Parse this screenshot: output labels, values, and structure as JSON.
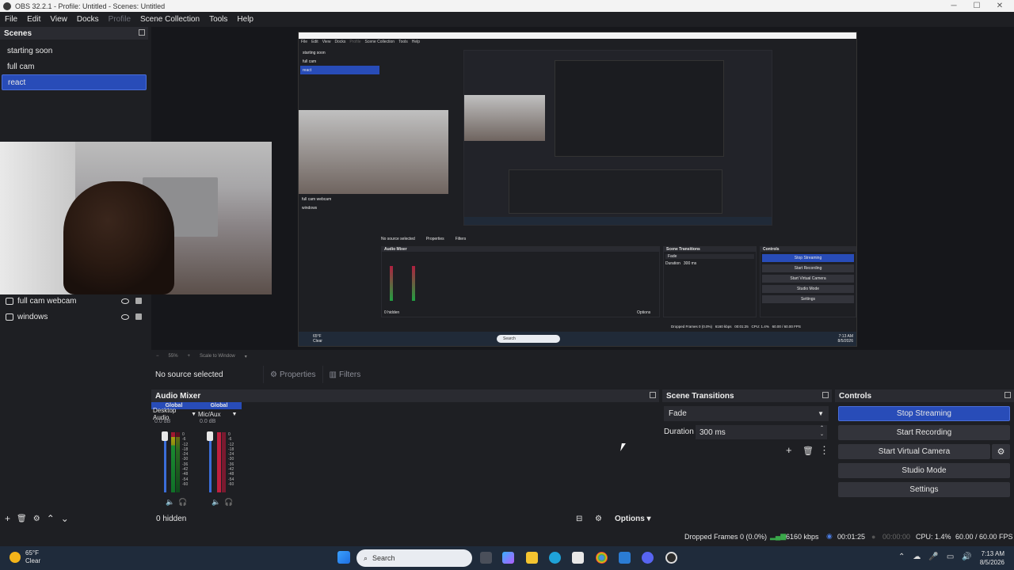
{
  "window": {
    "title": "OBS 32.2.1 - Profile: Untitled - Scenes: Untitled",
    "minimize": "─",
    "maximize": "☐",
    "close": "✕"
  },
  "menu": [
    "File",
    "Edit",
    "View",
    "Docks",
    "Profile",
    "Scene Collection",
    "Tools",
    "Help"
  ],
  "scenes": {
    "title": "Scenes",
    "items": [
      "starting soon",
      "full cam",
      "react"
    ],
    "active": "react"
  },
  "sources": {
    "items": [
      "full cam webcam",
      "windows"
    ]
  },
  "scene_tools": [
    "+",
    "🗑",
    "⚙",
    "⌃",
    "⌄"
  ],
  "preview": {
    "zoom": "55%",
    "scale_mode": "Scale to Window",
    "zoom_minus": "−",
    "zoom_plus": "+"
  },
  "nested": {
    "menu": [
      "File",
      "Edit",
      "View",
      "Docks",
      "Profile",
      "Scene Collection",
      "Tools",
      "Help"
    ],
    "scenes": [
      "starting soon",
      "full cam",
      "react"
    ],
    "sources": [
      "full cam webcam",
      "windows"
    ],
    "no_source": "No source selected",
    "properties": "Properties",
    "filters": "Filters",
    "audio_mixer": "Audio Mixer",
    "scene_transitions": "Scene Transitions",
    "controls": "Controls",
    "fade": "Fade",
    "duration_label": "Duration",
    "duration_value": "300 ms",
    "buttons": [
      "Stop Streaming",
      "Start Recording",
      "Start Virtual Camera",
      "Studio Mode",
      "Settings"
    ],
    "hidden": "0 hidden",
    "options": "Options",
    "status": "Dropped Frames 0 (0.0%)   6160 kbps   00:01:25   CPU: 1.4%   60.00 / 60.00 FPS",
    "weather": "65°F",
    "weather_sub": "Clear",
    "search": "Search",
    "time": "7:13 AM",
    "date": "8/5/2026"
  },
  "properties_bar": {
    "no_source": "No source selected",
    "properties": "Properties",
    "filters": "Filters"
  },
  "audio_mixer": {
    "title": "Audio Mixer",
    "channels": [
      {
        "scope": "Global",
        "name": "Desktop Audio",
        "db": "0.0 dB"
      },
      {
        "scope": "Global",
        "name": "Mic/Aux",
        "db": "0.0 dB"
      }
    ],
    "scale": [
      "0",
      "-6",
      "-12",
      "-18",
      "-24",
      "-30",
      "-36",
      "-42",
      "-48",
      "-54",
      "-60"
    ],
    "hidden": "0 hidden",
    "options": "Options"
  },
  "transitions": {
    "title": "Scene Transitions",
    "selected": "Fade",
    "duration_label": "Duration",
    "duration_value": "300 ms"
  },
  "controls": {
    "title": "Controls",
    "stop_streaming": "Stop Streaming",
    "start_recording": "Start Recording",
    "start_virtual_camera": "Start Virtual Camera",
    "studio_mode": "Studio Mode",
    "settings": "Settings"
  },
  "status": {
    "dropped_frames": "Dropped Frames 0 (0.0%)",
    "bitrate": "6160 kbps",
    "stream_time": "00:01:25",
    "record_time": "00:00:00",
    "cpu": "CPU: 1.4%",
    "fps": "60.00 / 60.00 FPS"
  },
  "taskbar": {
    "weather_temp": "65°F",
    "weather_desc": "Clear",
    "search_placeholder": "Search",
    "time": "7:13 AM",
    "date": "8/5/2026"
  },
  "colors": {
    "accent": "#284cb8",
    "panel": "#1e1f23",
    "header": "#2a2b31"
  }
}
